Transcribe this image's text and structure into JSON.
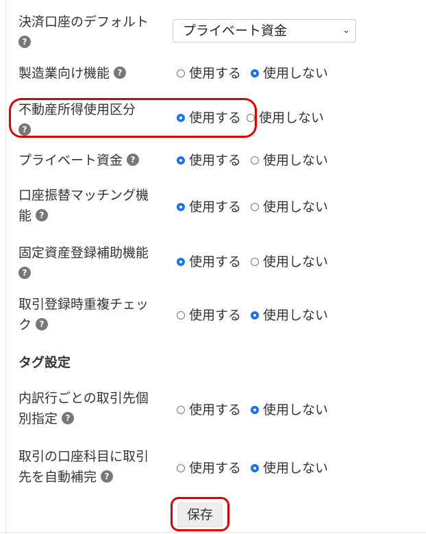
{
  "settings": {
    "default_account": {
      "label": "決済口座のデフォルト",
      "selected": "プライベート資金"
    },
    "rows": [
      {
        "label": "製造業向け機能",
        "use": "使用する",
        "nouse": "使用しない",
        "value": "nouse"
      },
      {
        "label": "不動産所得使用区分",
        "use": "使用する",
        "nouse": "使用しない",
        "value": "use"
      },
      {
        "label": "プライベート資金",
        "use": "使用する",
        "nouse": "使用しない",
        "value": "use"
      },
      {
        "label_line1": "口座振替マッチング機",
        "label_line2": "能",
        "use": "使用する",
        "nouse": "使用しない",
        "value": "use"
      },
      {
        "label": "固定資産登録補助機能",
        "use": "使用する",
        "nouse": "使用しない",
        "value": "use"
      },
      {
        "label_line1": "取引登録時重複チェッ",
        "label_line2": "ク",
        "use": "使用する",
        "nouse": "使用しない",
        "value": "nouse"
      }
    ],
    "tag_section_title": "タグ設定",
    "tag_rows": [
      {
        "label_line1": "内訳行ごとの取引先個",
        "label_line2": "別指定",
        "use": "使用する",
        "nouse": "使用しない",
        "value": "nouse"
      },
      {
        "label_line1": "取引の口座科目に取引",
        "label_line2": "先を自動補完",
        "use": "使用する",
        "nouse": "使用しない",
        "value": "nouse"
      }
    ],
    "help_glyph": "?",
    "save_label": "保存"
  },
  "annotation_color": "#e00000",
  "accent_color": "#1a73e8"
}
